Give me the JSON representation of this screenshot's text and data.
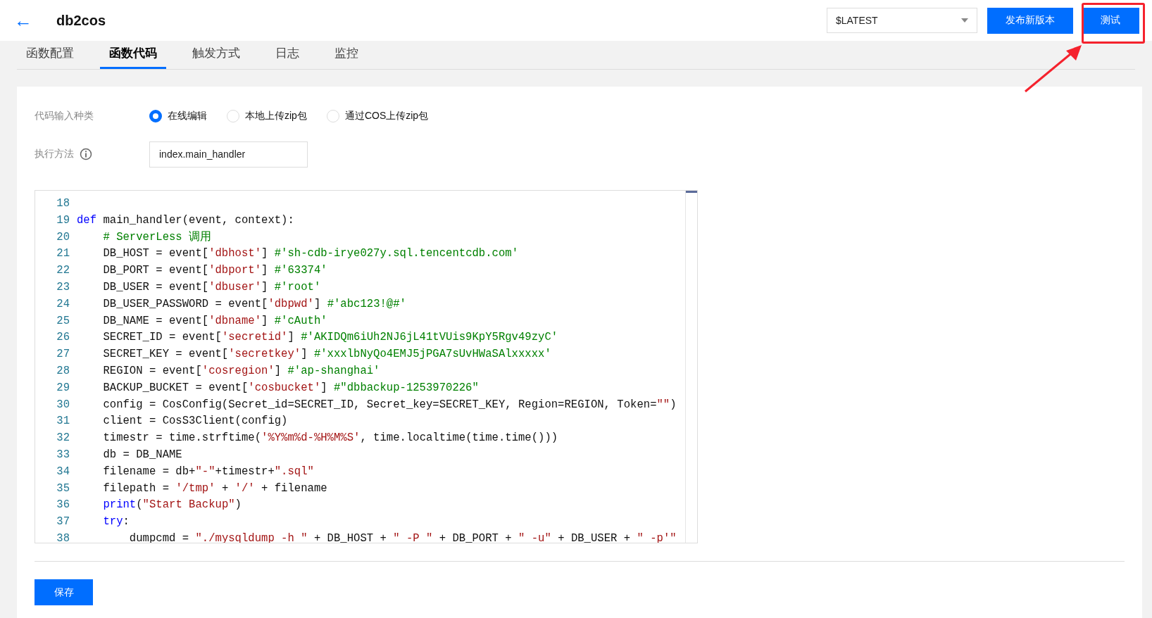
{
  "header": {
    "back": "←",
    "title": "db2cos",
    "version_select": "$LATEST",
    "publish_button": "发布新版本",
    "test_button": "测试",
    "annotation": {
      "highlighted": true
    }
  },
  "tabs": [
    {
      "label": "函数配置",
      "selected": false
    },
    {
      "label": "函数代码",
      "selected": true
    },
    {
      "label": "触发方式",
      "selected": false
    },
    {
      "label": "日志",
      "selected": false
    },
    {
      "label": "监控",
      "selected": false
    }
  ],
  "form": {
    "input_type_label": "代码输入种类",
    "options": [
      {
        "label": "在线编辑",
        "selected": true
      },
      {
        "label": "本地上传zip包",
        "selected": false
      },
      {
        "label": "通过COS上传zip包",
        "selected": false
      }
    ],
    "handler_label": "执行方法",
    "handler_value": "index.main_handler"
  },
  "editor": {
    "lines": [
      {
        "number": "18"
      },
      {
        "number": "19",
        "tokens": [
          {
            "kind": "keyword",
            "text": "def"
          },
          {
            "kind": "plain",
            "text": " main_handler(event, context):"
          }
        ]
      },
      {
        "number": "20",
        "tokens": [
          {
            "kind": "comment",
            "text": "    # ServerLess 调用"
          }
        ]
      },
      {
        "number": "21",
        "tokens": [
          {
            "kind": "plain",
            "text": "    DB_HOST = event["
          },
          {
            "kind": "string",
            "text": "'dbhost'"
          },
          {
            "kind": "plain",
            "text": "] "
          },
          {
            "kind": "comment",
            "text": "#'sh-cdb-irye027y.sql.tencentcdb.com'"
          }
        ]
      },
      {
        "number": "22",
        "tokens": [
          {
            "kind": "plain",
            "text": "    DB_PORT = event["
          },
          {
            "kind": "string",
            "text": "'dbport'"
          },
          {
            "kind": "plain",
            "text": "] "
          },
          {
            "kind": "comment",
            "text": "#'63374'"
          }
        ]
      },
      {
        "number": "23",
        "tokens": [
          {
            "kind": "plain",
            "text": "    DB_USER = event["
          },
          {
            "kind": "string",
            "text": "'dbuser'"
          },
          {
            "kind": "plain",
            "text": "] "
          },
          {
            "kind": "comment",
            "text": "#'root'"
          }
        ]
      },
      {
        "number": "24",
        "tokens": [
          {
            "kind": "plain",
            "text": "    DB_USER_PASSWORD = event["
          },
          {
            "kind": "string",
            "text": "'dbpwd'"
          },
          {
            "kind": "plain",
            "text": "] "
          },
          {
            "kind": "comment",
            "text": "#'abc123!@#'"
          }
        ]
      },
      {
        "number": "25",
        "tokens": [
          {
            "kind": "plain",
            "text": "    DB_NAME = event["
          },
          {
            "kind": "string",
            "text": "'dbname'"
          },
          {
            "kind": "plain",
            "text": "] "
          },
          {
            "kind": "comment",
            "text": "#'cAuth'"
          }
        ]
      },
      {
        "number": "26",
        "tokens": [
          {
            "kind": "plain",
            "text": "    SECRET_ID = event["
          },
          {
            "kind": "string",
            "text": "'secretid'"
          },
          {
            "kind": "plain",
            "text": "] "
          },
          {
            "kind": "comment",
            "text": "#'AKIDQm6iUh2NJ6jL41tVUis9KpY5Rgv49zyC'"
          }
        ]
      },
      {
        "number": "27",
        "tokens": [
          {
            "kind": "plain",
            "text": "    SECRET_KEY = event["
          },
          {
            "kind": "string",
            "text": "'secretkey'"
          },
          {
            "kind": "plain",
            "text": "] "
          },
          {
            "kind": "comment",
            "text": "#'xxxlbNyQo4EMJ5jPGA7sUvHWaSAlxxxxx'"
          }
        ]
      },
      {
        "number": "28",
        "tokens": [
          {
            "kind": "plain",
            "text": "    REGION = event["
          },
          {
            "kind": "string",
            "text": "'cosregion'"
          },
          {
            "kind": "plain",
            "text": "] "
          },
          {
            "kind": "comment",
            "text": "#'ap-shanghai'"
          }
        ]
      },
      {
        "number": "29",
        "tokens": [
          {
            "kind": "plain",
            "text": "    BACKUP_BUCKET = event["
          },
          {
            "kind": "string",
            "text": "'cosbucket'"
          },
          {
            "kind": "plain",
            "text": "] "
          },
          {
            "kind": "comment",
            "text": "#\"dbbackup-1253970226\""
          }
        ]
      },
      {
        "number": "30",
        "tokens": [
          {
            "kind": "plain",
            "text": "    config = CosConfig(Secret_id=SECRET_ID, Secret_key=SECRET_KEY, Region=REGION, Token="
          },
          {
            "kind": "string",
            "text": "\"\""
          },
          {
            "kind": "plain",
            "text": ")"
          }
        ]
      },
      {
        "number": "31",
        "tokens": [
          {
            "kind": "plain",
            "text": "    client = CosS3Client(config)"
          }
        ]
      },
      {
        "number": "32",
        "tokens": [
          {
            "kind": "plain",
            "text": "    timestr = time.strftime("
          },
          {
            "kind": "string",
            "text": "'%Y%m%d-%H%M%S'"
          },
          {
            "kind": "plain",
            "text": ", time.localtime(time.time()))"
          }
        ]
      },
      {
        "number": "33",
        "tokens": [
          {
            "kind": "plain",
            "text": "    db = DB_NAME"
          }
        ]
      },
      {
        "number": "34",
        "tokens": [
          {
            "kind": "plain",
            "text": "    filename = db+"
          },
          {
            "kind": "string",
            "text": "\"-\""
          },
          {
            "kind": "plain",
            "text": "+timestr+"
          },
          {
            "kind": "string",
            "text": "\".sql\""
          }
        ]
      },
      {
        "number": "35",
        "tokens": [
          {
            "kind": "plain",
            "text": "    filepath = "
          },
          {
            "kind": "string",
            "text": "'/tmp'"
          },
          {
            "kind": "plain",
            "text": " + "
          },
          {
            "kind": "string",
            "text": "'/'"
          },
          {
            "kind": "plain",
            "text": " + filename"
          }
        ]
      },
      {
        "number": "36",
        "tokens": [
          {
            "kind": "keyword",
            "text": "    print"
          },
          {
            "kind": "plain",
            "text": "("
          },
          {
            "kind": "string",
            "text": "\"Start Backup\""
          },
          {
            "kind": "plain",
            "text": ")"
          }
        ]
      },
      {
        "number": "37",
        "tokens": [
          {
            "kind": "keyword",
            "text": "    try"
          },
          {
            "kind": "plain",
            "text": ":"
          }
        ]
      },
      {
        "number": "38",
        "tokens": [
          {
            "kind": "plain",
            "text": "        dumpcmd = "
          },
          {
            "kind": "string",
            "text": "\"./mysqldump -h \""
          },
          {
            "kind": "plain",
            "text": " + DB_HOST + "
          },
          {
            "kind": "string",
            "text": "\" -P \""
          },
          {
            "kind": "plain",
            "text": " + DB_PORT + "
          },
          {
            "kind": "string",
            "text": "\" -u\""
          },
          {
            "kind": "plain",
            "text": " + DB_USER + "
          },
          {
            "kind": "string",
            "text": "\" -p'\""
          }
        ]
      }
    ]
  },
  "save_button": "保存"
}
